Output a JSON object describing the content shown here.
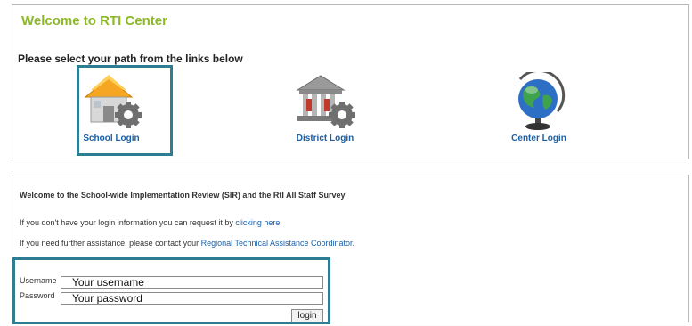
{
  "header": {
    "title": "Welcome to RTI Center",
    "prompt": "Please select your path from the links below"
  },
  "paths": [
    {
      "label": "School Login",
      "icon": "school-gear-icon"
    },
    {
      "label": "District Login",
      "icon": "district-building-gear-icon"
    },
    {
      "label": "Center Login",
      "icon": "globe-icon"
    }
  ],
  "info": {
    "intro": "Welcome to the School-wide Implementation Review (SIR) and the RtI All Staff Survey",
    "request_text": "If you don't have your login information you can request it by ",
    "request_link": "clicking here",
    "assist_text": "If you need further assistance, please contact your ",
    "assist_link": "Regional Technical Assistance Coordinator",
    "assist_end": "."
  },
  "login": {
    "username_label": "Username",
    "username_placeholder": "Your username",
    "password_label": "Password",
    "password_placeholder": "Your password",
    "button_label": "login"
  },
  "colors": {
    "title_green": "#8cb828",
    "link_blue": "#1b5fa6",
    "highlight_teal": "#2e7e93",
    "panel_border": "#b9b9b9"
  }
}
